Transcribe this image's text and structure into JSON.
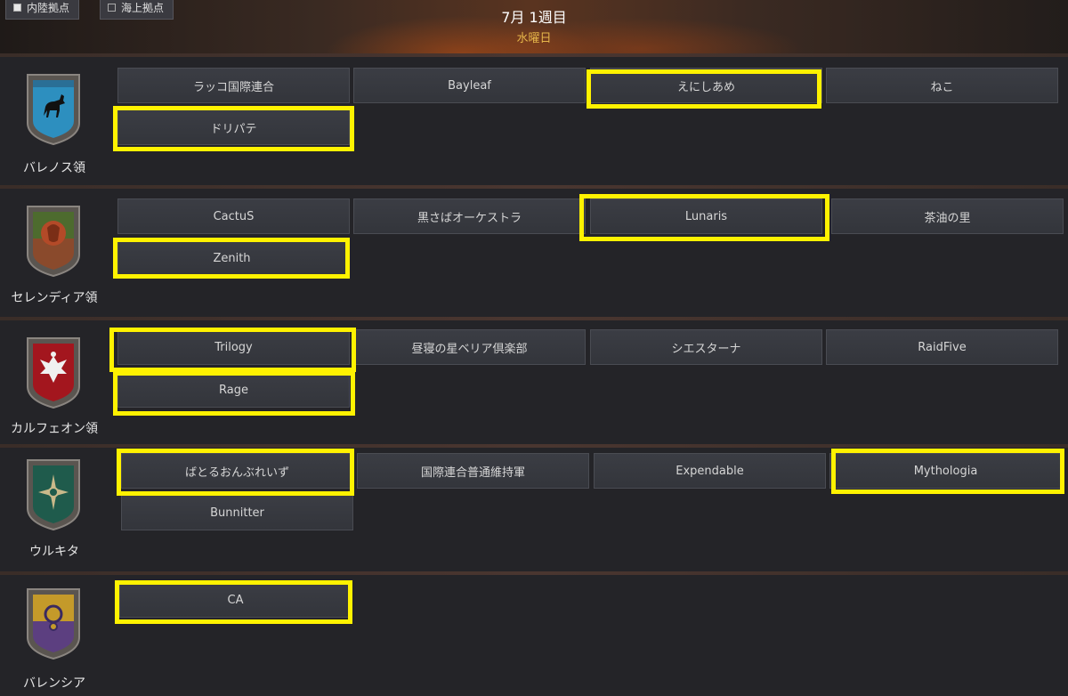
{
  "header": {
    "filters": [
      {
        "label": "内陸拠点",
        "checked": true
      },
      {
        "label": "海上拠点",
        "checked": false
      }
    ],
    "date": "7月 1週目",
    "weekday": "水曜日"
  },
  "territories": [
    {
      "name": "バレノス領",
      "guilds": [
        "ラッコ国際連合",
        "Bayleaf",
        "えにしあめ",
        "ねこ",
        "ドリパテ"
      ]
    },
    {
      "name": "セレンディア領",
      "guilds": [
        "CactuS",
        "黒さばオーケストラ",
        "Lunaris",
        "茶油の里",
        "Zenith"
      ]
    },
    {
      "name": "カルフェオン領",
      "guilds": [
        "Trilogy",
        "昼寝の星ベリア倶楽部",
        "シエスターナ",
        "RaidFive",
        "Rage"
      ]
    },
    {
      "name": "ウルキタ",
      "guilds": [
        "ばとるおんぶれいず",
        "国際連合普通維持軍",
        "Expendable",
        "Mythologia",
        "Bunnitter"
      ]
    },
    {
      "name": "バレンシア",
      "guilds": [
        "CA"
      ]
    }
  ],
  "colors": {
    "highlight": "#fff200",
    "accent": "#e6b64a"
  }
}
